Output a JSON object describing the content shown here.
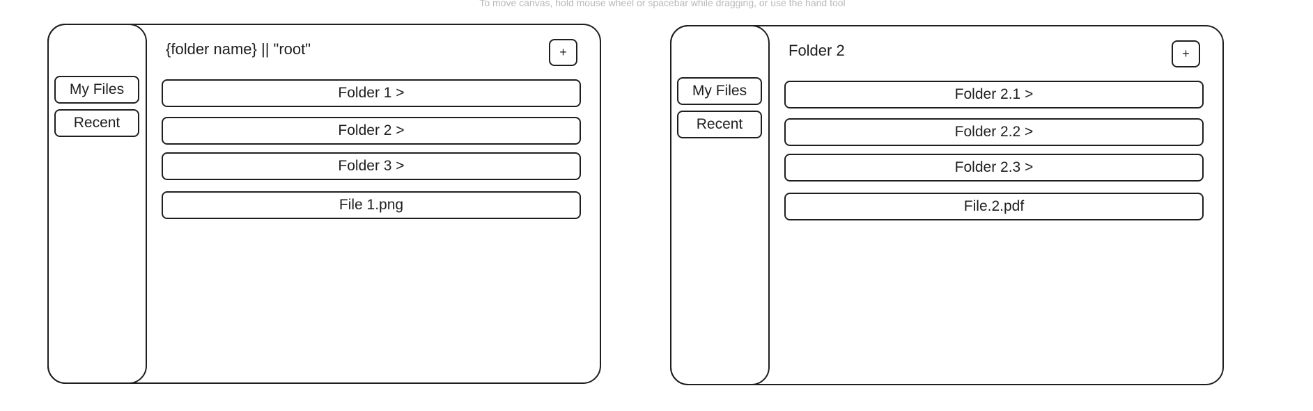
{
  "hint": "To move canvas, hold mouse wheel or spacebar while dragging, or use the hand tool",
  "screens": [
    {
      "title": "{folder name} || \"root\"",
      "add_label": "+",
      "sidebar": [
        "My Files",
        "Recent"
      ],
      "items": [
        "Folder 1 >",
        "Folder 2 >",
        "Folder 3 >",
        "File 1.png"
      ]
    },
    {
      "title": "Folder 2",
      "add_label": "+",
      "sidebar": [
        "My Files",
        "Recent"
      ],
      "items": [
        "Folder 2.1 >",
        "Folder 2.2 >",
        "Folder 2.3 >",
        "File.2.pdf"
      ]
    }
  ]
}
